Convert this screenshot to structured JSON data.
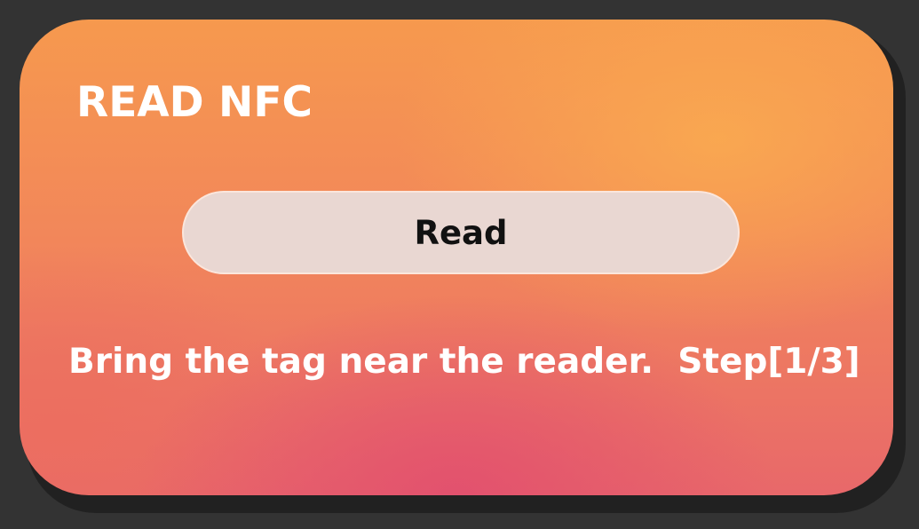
{
  "dialog": {
    "title": "READ NFC",
    "read_button_label": "Read",
    "status_text": "Bring the tag near the reader.  Step[1/3]"
  },
  "colors": {
    "background": "#333333",
    "card_orange": "#f6994e",
    "card_pink": "#e2506e",
    "button_fill": "#e9d7d2",
    "text": "#ffffff"
  }
}
